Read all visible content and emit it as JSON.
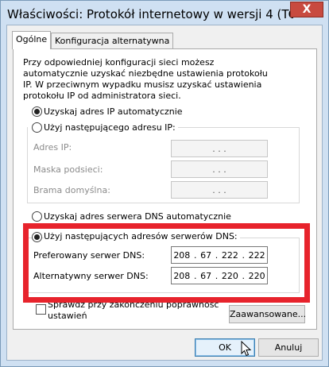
{
  "window": {
    "title": "Właściwości: Protokół internetowy w wersji 4 (TCP/IPv...",
    "close_glyph": "X"
  },
  "tabs": [
    {
      "label": "Ogólne",
      "active": true
    },
    {
      "label": "Konfiguracja alternatywna",
      "active": false
    }
  ],
  "description": "Przy odpowiedniej konfiguracji sieci możesz automatycznie uzyskać niezbędne ustawienia protokołu IP. W przeciwnym wypadku musisz uzyskać ustawienia protokołu IP od administratora sieci.",
  "ip": {
    "auto_label": "Uzyskaj adres IP automatycznie",
    "auto_checked": true,
    "manual_label": "Użyj następującego adresu IP:",
    "manual_checked": false,
    "fields": [
      {
        "label": "Adres IP:",
        "value": ".       .       ."
      },
      {
        "label": "Maska podsieci:",
        "value": ".       .       ."
      },
      {
        "label": "Brama domyślna:",
        "value": ".       .       ."
      }
    ]
  },
  "dns": {
    "auto_label": "Uzyskaj adres serwera DNS automatycznie",
    "auto_checked": false,
    "manual_label": "Użyj następujących adresów serwerów DNS:",
    "manual_checked": true,
    "preferred_label": "Preferowany serwer DNS:",
    "preferred_octets": [
      "208",
      "67",
      "222",
      "222"
    ],
    "alternate_label": "Alternatywny serwer DNS:",
    "alternate_octets": [
      "208",
      "67",
      "220",
      "220"
    ],
    "dot": "."
  },
  "validate": {
    "label_line1": "Sprawdź przy zakończeniu poprawność",
    "label_line2": "ustawień",
    "checked": false
  },
  "buttons": {
    "advanced": "Zaawansowane...",
    "ok": "OK",
    "cancel": "Anuluj"
  },
  "colors": {
    "highlight": "#e7232c",
    "titlebar": "#cfe0f2",
    "close_button": "#c84a3f"
  }
}
